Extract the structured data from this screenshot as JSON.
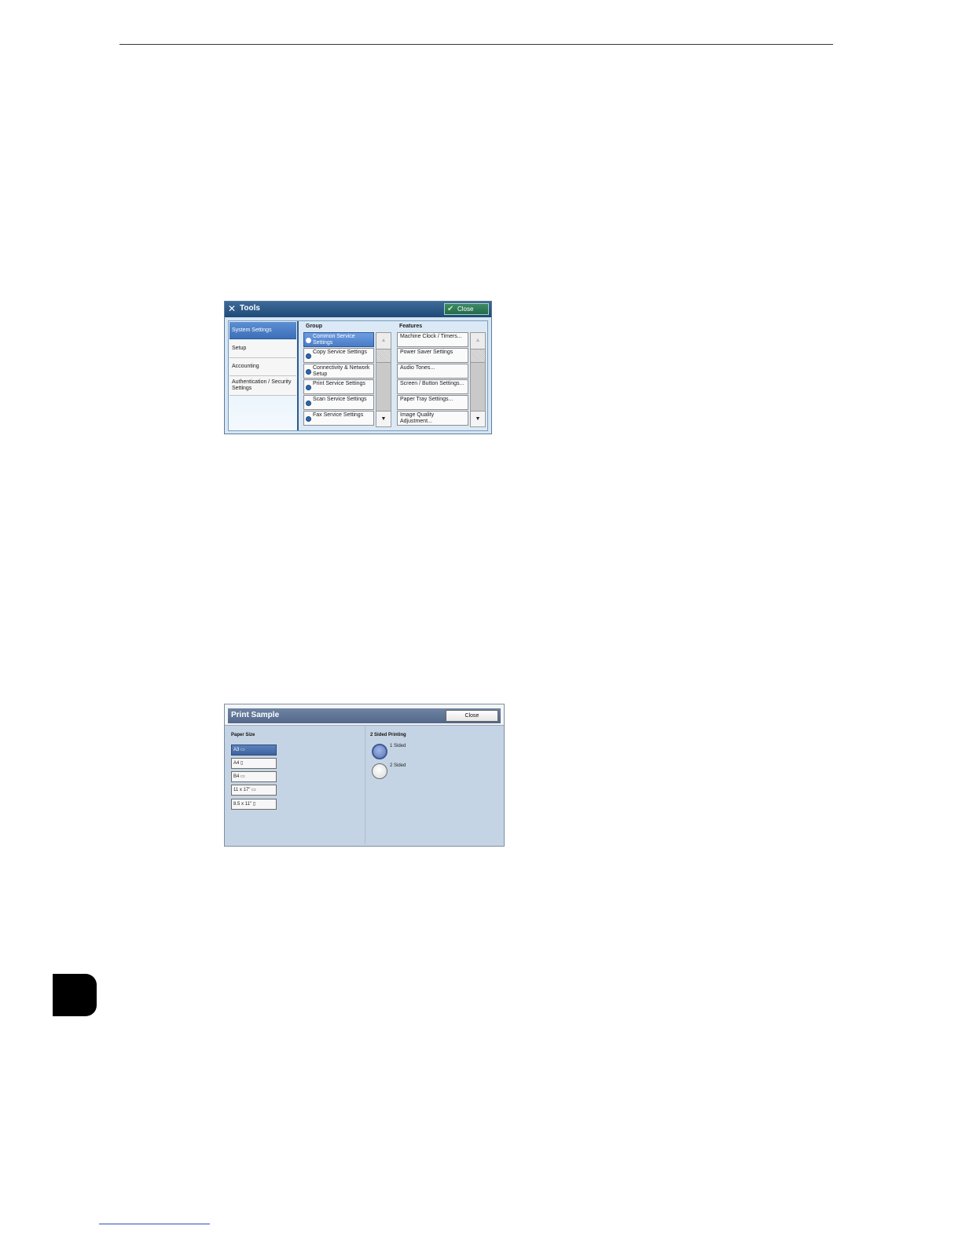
{
  "tools_screen": {
    "title": "Tools",
    "close_label": "Close",
    "left_tabs": [
      {
        "label": "System Settings",
        "selected": true
      },
      {
        "label": "Setup",
        "selected": false
      },
      {
        "label": "Accounting",
        "selected": false
      },
      {
        "label": "Authentication / Security Settings",
        "selected": false
      }
    ],
    "group_header": "Group",
    "features_header": "Features",
    "groups": [
      {
        "label": "Common Service Settings",
        "selected": true
      },
      {
        "label": "Copy Service Settings",
        "selected": false
      },
      {
        "label": "Connectivity & Network Setup",
        "selected": false
      },
      {
        "label": "Print Service Settings",
        "selected": false
      },
      {
        "label": "Scan Service Settings",
        "selected": false
      },
      {
        "label": "Fax Service Settings",
        "selected": false
      }
    ],
    "features": [
      "Machine Clock / Timers...",
      "Power Saver Settings",
      "Audio Tones...",
      "Screen / Button Settings...",
      "Paper Tray Settings...",
      "Image Quality Adjustment..."
    ],
    "scroll_up_glyph": "▲",
    "scroll_down_glyph": "▼"
  },
  "print_sample_screen": {
    "title": "Print Sample",
    "close_label": "Close",
    "paper_size_header": "Paper Size",
    "paper_sizes": [
      {
        "label": "A3 ▭",
        "selected": true
      },
      {
        "label": "A4 ▯",
        "selected": false
      },
      {
        "label": "B4 ▭",
        "selected": false
      },
      {
        "label": "11 x 17\" ▭",
        "selected": false
      },
      {
        "label": "8.5 x 11\" ▯",
        "selected": false
      }
    ],
    "sided_header": "2 Sided Printing",
    "sided_options": [
      {
        "label": "1 Sided",
        "selected": true
      },
      {
        "label": "2 Sided",
        "selected": false
      }
    ]
  },
  "colors": {
    "tools_titlebar": "#1f4a78",
    "tools_close": "#246c4c",
    "selected_blue": "#4a7cc6",
    "print_sample_titlebar": "#52678a",
    "print_sample_panel": "#c5d4e4",
    "chapter_tab": "#000000"
  },
  "icons": {
    "tools_title": "tools-wrench-screwdriver-icon",
    "tools_close": "checkmark-icon",
    "group_bullet": "circle-arrow-icon"
  }
}
